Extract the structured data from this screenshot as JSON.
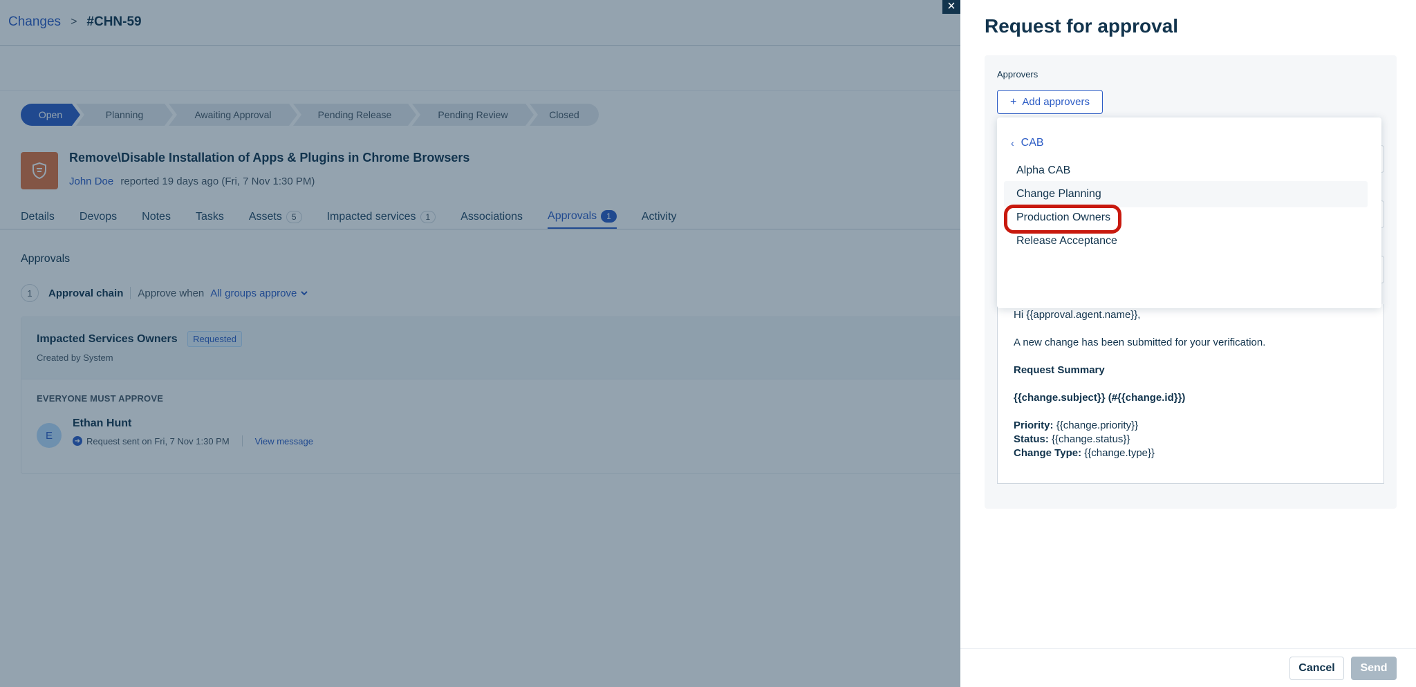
{
  "breadcrumb": {
    "root": "Changes",
    "separator": ">",
    "current": "#CHN-59"
  },
  "stages": [
    "Open",
    "Planning",
    "Awaiting Approval",
    "Pending Release",
    "Pending Review",
    "Closed"
  ],
  "active_stage": "Open",
  "ticket": {
    "title": "Remove\\Disable Installation of Apps & Plugins in Chrome Browsers",
    "reporter": "John Doe",
    "reported_text": "reported 19 days ago (Fri, 7 Nov 1:30 PM)"
  },
  "tabs": [
    {
      "label": "Details",
      "count": ""
    },
    {
      "label": "Devops",
      "count": ""
    },
    {
      "label": "Notes",
      "count": ""
    },
    {
      "label": "Tasks",
      "count": ""
    },
    {
      "label": "Assets",
      "count": "5"
    },
    {
      "label": "Impacted services",
      "count": "1"
    },
    {
      "label": "Associations",
      "count": ""
    },
    {
      "label": "Approvals",
      "count": "1"
    },
    {
      "label": "Activity",
      "count": ""
    }
  ],
  "active_tab": "Approvals",
  "approvals": {
    "heading": "Approvals",
    "chain_number": "1",
    "chain_label": "Approval chain",
    "approve_when_label": "Approve when",
    "approve_when_value": "All groups approve",
    "group": {
      "name": "Impacted Services Owners",
      "badge": "Requested",
      "created_by": "Created by System",
      "rule": "EVERYONE MUST APPROVE",
      "approver": {
        "initial": "E",
        "name": "Ethan Hunt",
        "status": "Request sent on Fri, 7 Nov 1:30 PM",
        "view_link": "View message"
      }
    }
  },
  "panel": {
    "title": "Request for approval",
    "approvers_label": "Approvers",
    "add_approvers": "Add approvers",
    "dropdown": {
      "back_label": "CAB",
      "items": [
        "Alpha CAB",
        "Change Planning",
        "Production Owners",
        "Release Acceptance"
      ],
      "highlighted": "Change Planning"
    },
    "message": {
      "greeting": "Hi {{approval.agent.name}},",
      "line1": "A new change has been submitted for your verification.",
      "summary_heading": "Request Summary",
      "subject_line": "{{change.subject}} (#{{change.id}})",
      "priority_label": "Priority:",
      "priority_value": "{{change.priority}}",
      "status_label": "Status:",
      "status_value": "{{change.status}}",
      "type_label": "Change Type:",
      "type_value": "{{change.type}}"
    },
    "cancel": "Cancel",
    "send": "Send"
  },
  "colors": {
    "brand": "#2c5cc5",
    "highlight_ring": "#c8190e",
    "overlay": "#12344d"
  }
}
